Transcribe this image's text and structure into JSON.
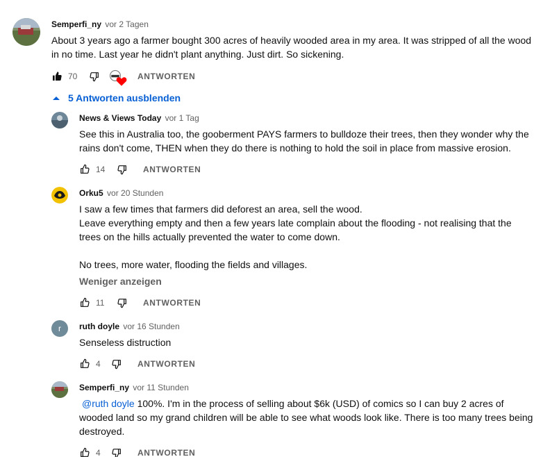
{
  "comment": {
    "author": "Semperfi_ny",
    "time": "vor 2 Tagen",
    "lines": [
      "About 3 years ago a farmer bought 300 acres of heavily wooded area in my area. It was stripped of all the wood in no time. Last year he didn't plant anything. Just dirt. So sickening."
    ],
    "likes": "70",
    "reply_label": "ANTWORTEN"
  },
  "replies_toggle": "5 Antworten ausblenden",
  "replies": [
    {
      "author": "News & Views Today",
      "time": "vor 1 Tag",
      "lines": [
        "See this in Australia too, the gooberment PAYS farmers to bulldoze their trees, then they wonder why the rains don't come, THEN when they do there is nothing to hold the soil in place from massive erosion."
      ],
      "likes": "14",
      "reply_label": "ANTWORTEN"
    },
    {
      "author": "Orku5",
      "time": "vor 20 Stunden",
      "lines": [
        "I saw a few times that farmers did deforest an area, sell the wood.",
        "Leave everything empty and then a few years late complain about the flooding - not realising that the trees on the hills actually prevented the water to come down.",
        "",
        "No trees, more water, flooding the fields and villages."
      ],
      "show_less": "Weniger anzeigen",
      "likes": "11",
      "reply_label": "ANTWORTEN"
    },
    {
      "author": "ruth doyle",
      "time": "vor 16 Stunden",
      "avatar_letter": "r",
      "lines": [
        "Senseless distruction"
      ],
      "likes": "4",
      "reply_label": "ANTWORTEN"
    },
    {
      "author": "Semperfi_ny",
      "time": "vor 11 Stunden",
      "mention": "@ruth doyle",
      "text": " 100%. I'm in the process of selling about $6k (USD) of comics so I can buy 2 acres of wooded land so my grand children will be able to see what woods look like. There is too many trees being destroyed.",
      "likes": "4",
      "reply_label": "ANTWORTEN"
    }
  ],
  "colors": {
    "link": "#065fd4",
    "secondary": "#606060",
    "heart": "#ff0000"
  }
}
